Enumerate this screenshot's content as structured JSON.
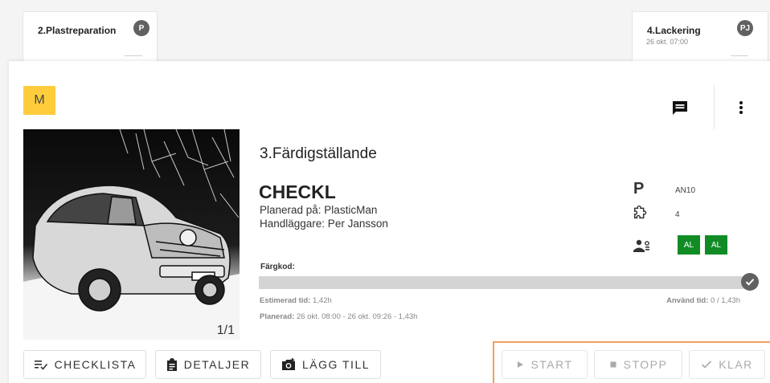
{
  "top_cards": {
    "left": {
      "title": "2.Plastreparation",
      "avatar": "P"
    },
    "right": {
      "title": "4.Lackering",
      "date": "26 okt. 07:00",
      "avatar": "PJ"
    }
  },
  "badge": "M",
  "icons": {
    "message": "message-icon",
    "more": "more-vert-icon",
    "puzzle": "puzzle-icon",
    "people": "people-icon",
    "check": "check-circle-icon"
  },
  "photo": {
    "counter": "1/1"
  },
  "stage_title": "3.Färdigställande",
  "job": {
    "code": "CHECKL",
    "planned_on": "Planerad på: PlasticMan",
    "handler": "Handläggare: Per Jansson"
  },
  "meta": {
    "p_label": "P",
    "p_value": "AN10",
    "parts_count": "4",
    "assignees": [
      "AL",
      "AL"
    ]
  },
  "color_code_label": "Färgkod:",
  "progress": {
    "fraction": 0.0
  },
  "times": {
    "estimated_label": "Estimerad tid:",
    "estimated_value": "1,42h",
    "used_label": "Använd tid:",
    "used_value": "0 / 1,43h",
    "planned_label": "Planerad:",
    "planned_value": "26 okt. 08:00 - 26 okt. 09:26 - 1,43h"
  },
  "buttons": {
    "checklist": "CHECKLISTA",
    "details": "DETALJER",
    "add": "LÄGG TILL",
    "start": "START",
    "stop": "STOPP",
    "done": "KLAR"
  },
  "colors": {
    "badge_yellow": "#ffcd3c",
    "assignee_green": "#118c25",
    "highlight_orange": "#f0a060"
  }
}
